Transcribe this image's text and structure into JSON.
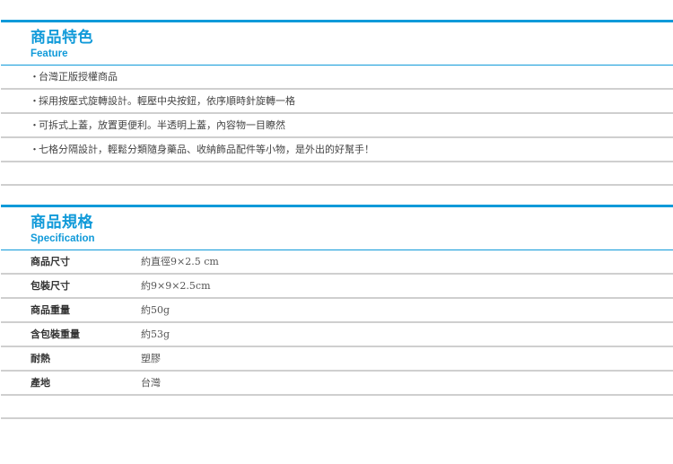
{
  "feature": {
    "title": "商品特色",
    "subtitle": "Feature",
    "bullet": "・",
    "items": [
      "台灣正版授權商品",
      "採用按壓式旋轉設計。輕壓中央按鈕，依序順時針旋轉一格",
      "可拆式上蓋，放置更便利。半透明上蓋，內容物一目瞭然",
      "七格分隔設計，輕鬆分類隨身藥品、收納飾品配件等小物，是外出的好幫手！"
    ]
  },
  "specification": {
    "title": "商品規格",
    "subtitle": "Specification",
    "rows": [
      {
        "label": "商品尺寸",
        "value": "約直徑9×2.5 cm"
      },
      {
        "label": "包裝尺寸",
        "value": "約9×9×2.5cm"
      },
      {
        "label": "商品重量",
        "value": "約50g"
      },
      {
        "label": "含包裝重量",
        "value": "約53g"
      },
      {
        "label": "耐熱",
        "value": "塑膠"
      },
      {
        "label": "產地",
        "value": "台灣"
      }
    ]
  },
  "colors": {
    "accent": "#109ad9",
    "divider": "#cfcfcf",
    "text": "#444444"
  }
}
